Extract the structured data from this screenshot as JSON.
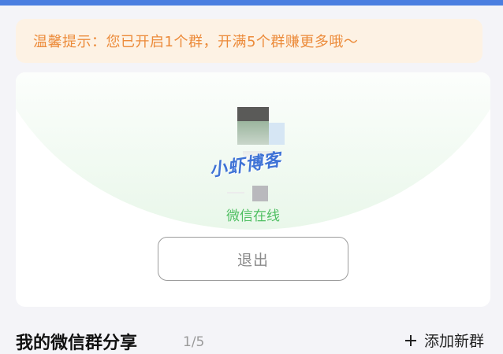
{
  "notice": {
    "text": "温馨提示：您已开启1个群，开满5个群赚更多哦～"
  },
  "card": {
    "watermark": "小虾博客",
    "status": "微信在线",
    "logout_label": "退出"
  },
  "section": {
    "title": "我的微信群分享",
    "count": "1/5",
    "add_label": "添加新群"
  },
  "colors": {
    "accent_bar": "#4a7ee0",
    "notice_text": "#ec8b3a",
    "notice_bg": "#fdf2e4",
    "status_green": "#4fbf62"
  },
  "icons": {
    "add": "plus-icon"
  }
}
